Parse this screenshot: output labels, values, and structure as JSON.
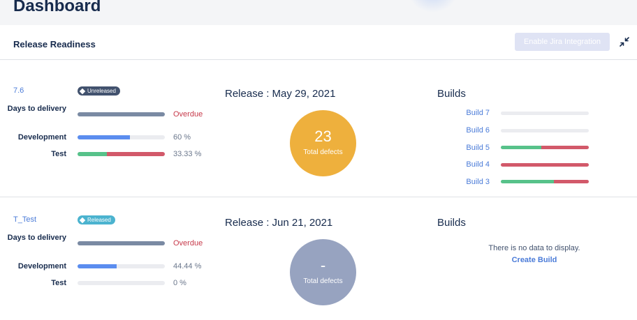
{
  "header": {
    "title": "Dashboard"
  },
  "section": {
    "title": "Release Readiness",
    "jira_button": "Enable Jira Integration"
  },
  "colors": {
    "accent": "#4a7bd8",
    "overdue": "#c7394a",
    "days_bar": "#7a8aa3",
    "dev_bar": "#5b8def",
    "test_pass": "#57c28a",
    "test_fail": "#d2596a",
    "defects_orange": "#eeb03d",
    "defects_gray": "#97a3c0"
  },
  "releases": [
    {
      "version": "7.6",
      "status": "Unreleased",
      "days_label": "Days to delivery",
      "days_value": "Overdue",
      "days_fraction": 1.0,
      "development_label": "Development",
      "development_value": "60 %",
      "development_fraction": 0.6,
      "test_label": "Test",
      "test_value": "33.33 %",
      "test_pass_fraction": 0.3333,
      "test_fail_fraction": 0.6667,
      "release_date": "Release : May 29, 2021",
      "defects_count": "23",
      "defects_label": "Total defects",
      "builds_title": "Builds",
      "builds": [
        {
          "name": "Build 7",
          "pass": 0.0,
          "fail": 0.0
        },
        {
          "name": "Build 6",
          "pass": 0.0,
          "fail": 0.0
        },
        {
          "name": "Build 5",
          "pass": 0.46,
          "fail": 0.54
        },
        {
          "name": "Build 4",
          "pass": 0.0,
          "fail": 1.0
        },
        {
          "name": "Build 3",
          "pass": 0.6,
          "fail": 0.4
        }
      ]
    },
    {
      "version": "T_Test",
      "status": "Released",
      "days_label": "Days to delivery",
      "days_value": "Overdue",
      "days_fraction": 1.0,
      "development_label": "Development",
      "development_value": "44.44 %",
      "development_fraction": 0.4444,
      "test_label": "Test",
      "test_value": "0 %",
      "test_pass_fraction": 0.0,
      "test_fail_fraction": 0.0,
      "release_date": "Release : Jun 21, 2021",
      "defects_count": "-",
      "defects_label": "Total defects",
      "builds_title": "Builds",
      "no_data_text": "There is no data to display.",
      "create_build_label": "Create Build"
    }
  ]
}
